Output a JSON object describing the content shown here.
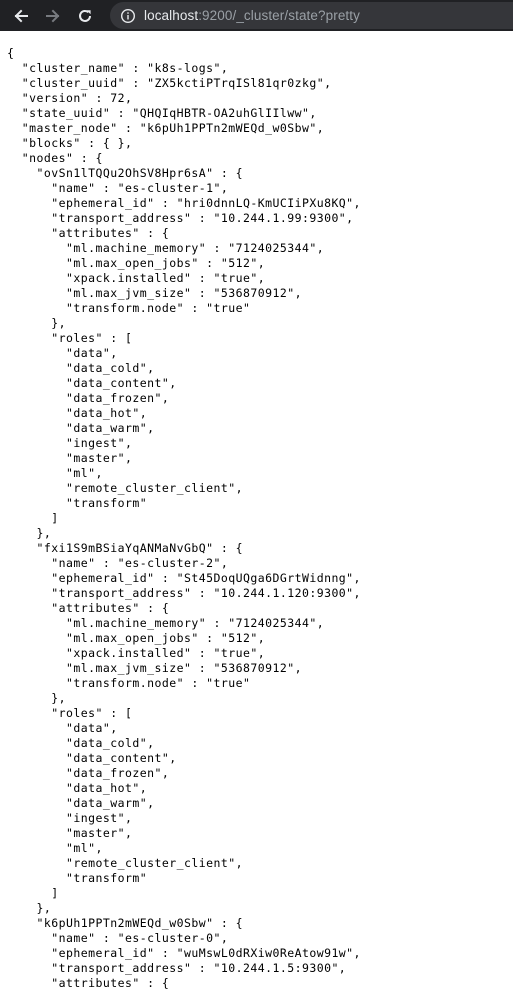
{
  "browser": {
    "url_host": "localhost",
    "url_rest": ":9200/_cluster/state?pretty",
    "colors": {
      "toolbar_bg": "#202124",
      "omnibox_bg": "#35363a",
      "icon": "#e8eaed",
      "icon_disabled": "#777a7f",
      "url_host": "#e8eaed",
      "url_rest": "#9aa0a6"
    }
  },
  "json_lines": [
    "{",
    "  \"cluster_name\" : \"k8s-logs\",",
    "  \"cluster_uuid\" : \"ZX5kctiPTrqISl81qr0zkg\",",
    "  \"version\" : 72,",
    "  \"state_uuid\" : \"QHQIqHBTR-OA2uhGlIIlww\",",
    "  \"master_node\" : \"k6pUh1PPTn2mWEQd_w0Sbw\",",
    "  \"blocks\" : { },",
    "  \"nodes\" : {",
    "    \"ovSn1lTQQu2OhSV8Hpr6sA\" : {",
    "      \"name\" : \"es-cluster-1\",",
    "      \"ephemeral_id\" : \"hri0dnnLQ-KmUCIiPXu8KQ\",",
    "      \"transport_address\" : \"10.244.1.99:9300\",",
    "      \"attributes\" : {",
    "        \"ml.machine_memory\" : \"7124025344\",",
    "        \"ml.max_open_jobs\" : \"512\",",
    "        \"xpack.installed\" : \"true\",",
    "        \"ml.max_jvm_size\" : \"536870912\",",
    "        \"transform.node\" : \"true\"",
    "      },",
    "      \"roles\" : [",
    "        \"data\",",
    "        \"data_cold\",",
    "        \"data_content\",",
    "        \"data_frozen\",",
    "        \"data_hot\",",
    "        \"data_warm\",",
    "        \"ingest\",",
    "        \"master\",",
    "        \"ml\",",
    "        \"remote_cluster_client\",",
    "        \"transform\"",
    "      ]",
    "    },",
    "    \"fxi1S9mBSiaYqANMaNvGbQ\" : {",
    "      \"name\" : \"es-cluster-2\",",
    "      \"ephemeral_id\" : \"St45DoqUQga6DGrtWidnng\",",
    "      \"transport_address\" : \"10.244.1.120:9300\",",
    "      \"attributes\" : {",
    "        \"ml.machine_memory\" : \"7124025344\",",
    "        \"ml.max_open_jobs\" : \"512\",",
    "        \"xpack.installed\" : \"true\",",
    "        \"ml.max_jvm_size\" : \"536870912\",",
    "        \"transform.node\" : \"true\"",
    "      },",
    "      \"roles\" : [",
    "        \"data\",",
    "        \"data_cold\",",
    "        \"data_content\",",
    "        \"data_frozen\",",
    "        \"data_hot\",",
    "        \"data_warm\",",
    "        \"ingest\",",
    "        \"master\",",
    "        \"ml\",",
    "        \"remote_cluster_client\",",
    "        \"transform\"",
    "      ]",
    "    },",
    "    \"k6pUh1PPTn2mWEQd_w0Sbw\" : {",
    "      \"name\" : \"es-cluster-0\",",
    "      \"ephemeral_id\" : \"wuMswL0dRXiw0ReAtow91w\",",
    "      \"transport_address\" : \"10.244.1.5:9300\",",
    "      \"attributes\" : {"
  ]
}
